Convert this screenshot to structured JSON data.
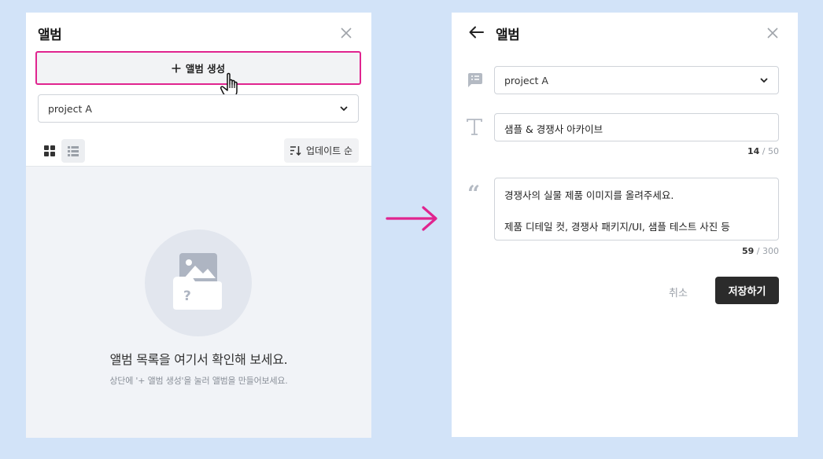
{
  "left_panel": {
    "title": "앨범",
    "create_button_label": "앨범 생성",
    "project_select": "project A",
    "sort_label": "업데이트 순",
    "empty_title": "앨범 목록을 여기서 확인해 보세요.",
    "empty_subtitle": "상단에 '+ 앨범 생성'을 눌러 앨범을 만들어보세요."
  },
  "right_panel": {
    "title": "앨범",
    "project_select": "project A",
    "name_value": "샘플 & 경쟁사 아카이브",
    "name_count": "14",
    "name_max": "/ 50",
    "description_line1": "경쟁사의 실물 제품 이미지를 올려주세요.",
    "description_line2": "제품 디테일 컷, 경쟁사 패키지/UI, 샘플 테스트 사진 등",
    "description_count": "59",
    "description_max": "/ 300",
    "cancel_label": "취소",
    "save_label": "저장하기"
  },
  "icons": [
    "close-icon",
    "plus-icon",
    "hand-cursor-icon",
    "chevron-down-icon",
    "grid-view-icon",
    "list-view-icon",
    "sort-icon",
    "image-placeholder-icon",
    "back-arrow-icon",
    "comment-icon",
    "text-icon",
    "quote-icon",
    "right-arrow-icon"
  ],
  "colors": {
    "accent": "#e0248f",
    "background": "#d2e3f8",
    "save_button": "#2b2b2b"
  }
}
